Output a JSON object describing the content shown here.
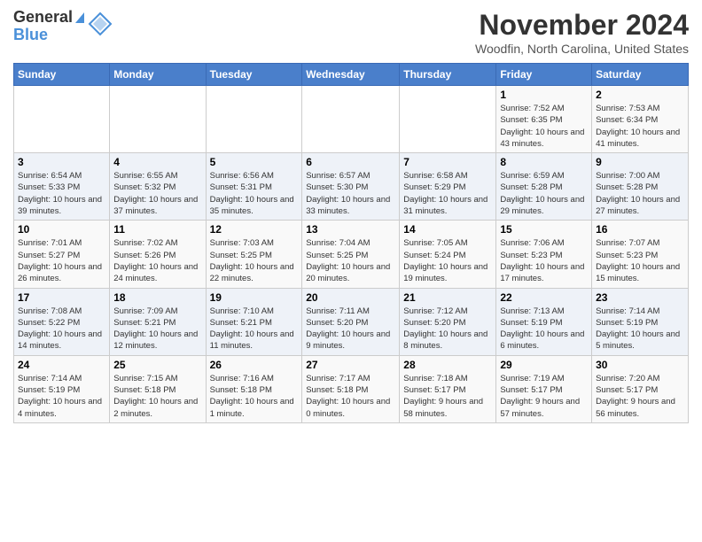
{
  "header": {
    "logo_general": "General",
    "logo_blue": "Blue",
    "month_title": "November 2024",
    "location": "Woodfin, North Carolina, United States"
  },
  "calendar": {
    "days_of_week": [
      "Sunday",
      "Monday",
      "Tuesday",
      "Wednesday",
      "Thursday",
      "Friday",
      "Saturday"
    ],
    "weeks": [
      [
        {
          "day": "",
          "info": ""
        },
        {
          "day": "",
          "info": ""
        },
        {
          "day": "",
          "info": ""
        },
        {
          "day": "",
          "info": ""
        },
        {
          "day": "",
          "info": ""
        },
        {
          "day": "1",
          "info": "Sunrise: 7:52 AM\nSunset: 6:35 PM\nDaylight: 10 hours and 43 minutes."
        },
        {
          "day": "2",
          "info": "Sunrise: 7:53 AM\nSunset: 6:34 PM\nDaylight: 10 hours and 41 minutes."
        }
      ],
      [
        {
          "day": "3",
          "info": "Sunrise: 6:54 AM\nSunset: 5:33 PM\nDaylight: 10 hours and 39 minutes."
        },
        {
          "day": "4",
          "info": "Sunrise: 6:55 AM\nSunset: 5:32 PM\nDaylight: 10 hours and 37 minutes."
        },
        {
          "day": "5",
          "info": "Sunrise: 6:56 AM\nSunset: 5:31 PM\nDaylight: 10 hours and 35 minutes."
        },
        {
          "day": "6",
          "info": "Sunrise: 6:57 AM\nSunset: 5:30 PM\nDaylight: 10 hours and 33 minutes."
        },
        {
          "day": "7",
          "info": "Sunrise: 6:58 AM\nSunset: 5:29 PM\nDaylight: 10 hours and 31 minutes."
        },
        {
          "day": "8",
          "info": "Sunrise: 6:59 AM\nSunset: 5:28 PM\nDaylight: 10 hours and 29 minutes."
        },
        {
          "day": "9",
          "info": "Sunrise: 7:00 AM\nSunset: 5:28 PM\nDaylight: 10 hours and 27 minutes."
        }
      ],
      [
        {
          "day": "10",
          "info": "Sunrise: 7:01 AM\nSunset: 5:27 PM\nDaylight: 10 hours and 26 minutes."
        },
        {
          "day": "11",
          "info": "Sunrise: 7:02 AM\nSunset: 5:26 PM\nDaylight: 10 hours and 24 minutes."
        },
        {
          "day": "12",
          "info": "Sunrise: 7:03 AM\nSunset: 5:25 PM\nDaylight: 10 hours and 22 minutes."
        },
        {
          "day": "13",
          "info": "Sunrise: 7:04 AM\nSunset: 5:25 PM\nDaylight: 10 hours and 20 minutes."
        },
        {
          "day": "14",
          "info": "Sunrise: 7:05 AM\nSunset: 5:24 PM\nDaylight: 10 hours and 19 minutes."
        },
        {
          "day": "15",
          "info": "Sunrise: 7:06 AM\nSunset: 5:23 PM\nDaylight: 10 hours and 17 minutes."
        },
        {
          "day": "16",
          "info": "Sunrise: 7:07 AM\nSunset: 5:23 PM\nDaylight: 10 hours and 15 minutes."
        }
      ],
      [
        {
          "day": "17",
          "info": "Sunrise: 7:08 AM\nSunset: 5:22 PM\nDaylight: 10 hours and 14 minutes."
        },
        {
          "day": "18",
          "info": "Sunrise: 7:09 AM\nSunset: 5:21 PM\nDaylight: 10 hours and 12 minutes."
        },
        {
          "day": "19",
          "info": "Sunrise: 7:10 AM\nSunset: 5:21 PM\nDaylight: 10 hours and 11 minutes."
        },
        {
          "day": "20",
          "info": "Sunrise: 7:11 AM\nSunset: 5:20 PM\nDaylight: 10 hours and 9 minutes."
        },
        {
          "day": "21",
          "info": "Sunrise: 7:12 AM\nSunset: 5:20 PM\nDaylight: 10 hours and 8 minutes."
        },
        {
          "day": "22",
          "info": "Sunrise: 7:13 AM\nSunset: 5:19 PM\nDaylight: 10 hours and 6 minutes."
        },
        {
          "day": "23",
          "info": "Sunrise: 7:14 AM\nSunset: 5:19 PM\nDaylight: 10 hours and 5 minutes."
        }
      ],
      [
        {
          "day": "24",
          "info": "Sunrise: 7:14 AM\nSunset: 5:19 PM\nDaylight: 10 hours and 4 minutes."
        },
        {
          "day": "25",
          "info": "Sunrise: 7:15 AM\nSunset: 5:18 PM\nDaylight: 10 hours and 2 minutes."
        },
        {
          "day": "26",
          "info": "Sunrise: 7:16 AM\nSunset: 5:18 PM\nDaylight: 10 hours and 1 minute."
        },
        {
          "day": "27",
          "info": "Sunrise: 7:17 AM\nSunset: 5:18 PM\nDaylight: 10 hours and 0 minutes."
        },
        {
          "day": "28",
          "info": "Sunrise: 7:18 AM\nSunset: 5:17 PM\nDaylight: 9 hours and 58 minutes."
        },
        {
          "day": "29",
          "info": "Sunrise: 7:19 AM\nSunset: 5:17 PM\nDaylight: 9 hours and 57 minutes."
        },
        {
          "day": "30",
          "info": "Sunrise: 7:20 AM\nSunset: 5:17 PM\nDaylight: 9 hours and 56 minutes."
        }
      ]
    ]
  }
}
